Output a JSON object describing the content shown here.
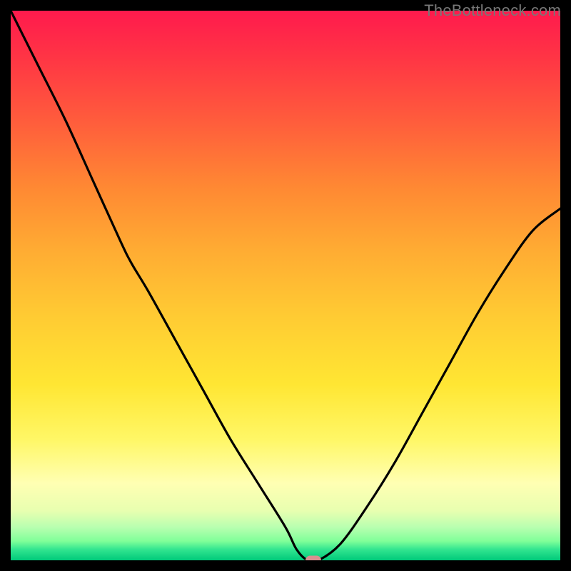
{
  "watermark": "TheBottleneck.com",
  "colors": {
    "frame": "#000000",
    "curve": "#000000",
    "marker": "#d89090",
    "gradient_top": "#ff1a4d",
    "gradient_bottom": "#00c97a"
  },
  "chart_data": {
    "type": "line",
    "title": "",
    "xlabel": "",
    "ylabel": "",
    "xlim": [
      0,
      100
    ],
    "ylim": [
      0,
      100
    ],
    "grid": false,
    "legend": false,
    "note": "No axis tick labels are rendered in the image; data series values are estimated from pixel positions relative to plot area (0–100 range on each axis, origin bottom-left).",
    "series": [
      {
        "name": "bottleneck-curve",
        "x": [
          0,
          5,
          10,
          15,
          20,
          22,
          25,
          30,
          35,
          40,
          45,
          50,
          52,
          54,
          56,
          60,
          65,
          70,
          75,
          80,
          85,
          90,
          95,
          100
        ],
        "y": [
          100,
          90,
          80,
          69,
          58,
          54,
          49,
          40,
          31,
          22,
          14,
          6,
          2,
          0,
          0,
          3,
          10,
          18,
          27,
          36,
          45,
          53,
          60,
          64
        ]
      }
    ],
    "marker": {
      "x": 55,
      "y": 0
    }
  }
}
